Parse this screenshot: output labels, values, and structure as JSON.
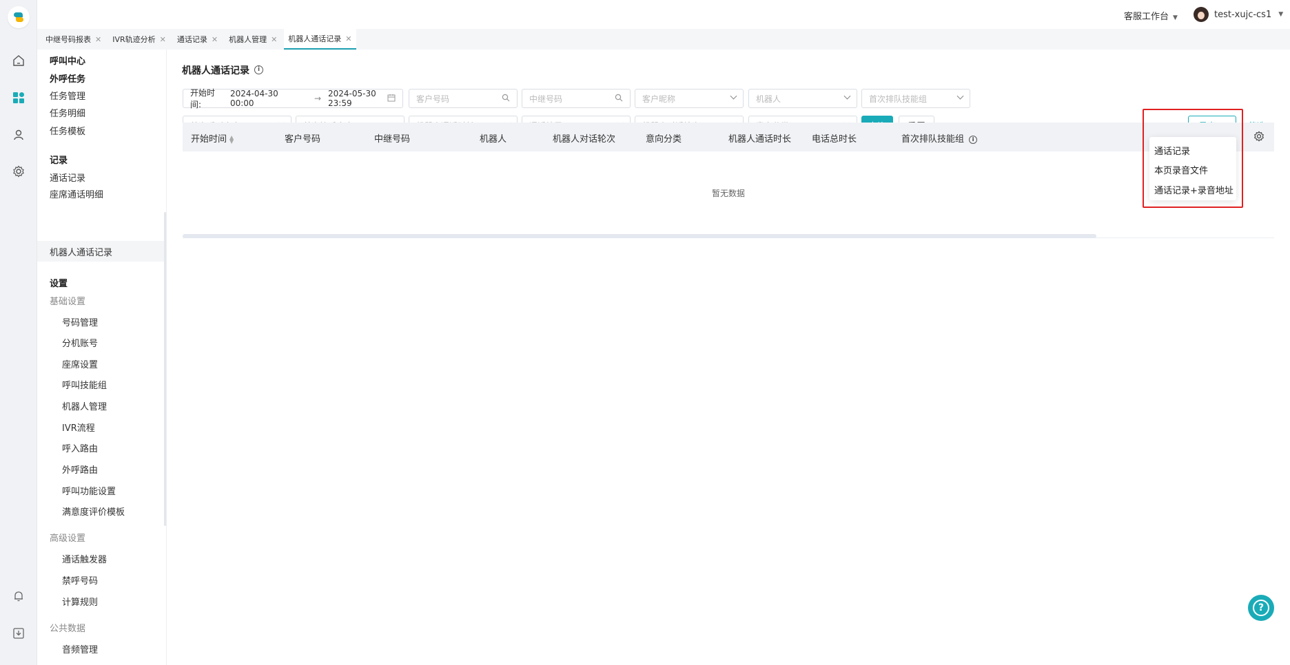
{
  "header": {
    "workspace": "客服工作台",
    "username": "test-xujc-cs1"
  },
  "tabs": [
    {
      "label": "中继号码报表"
    },
    {
      "label": "IVR轨迹分析"
    },
    {
      "label": "通话记录"
    },
    {
      "label": "机器人管理"
    },
    {
      "label": "机器人通话记录",
      "active": true
    }
  ],
  "rail_icons": [
    "home-icon",
    "apps-icon",
    "user-icon",
    "settings-icon",
    "bell-icon",
    "download-icon"
  ],
  "sidebar": {
    "call_center": "呼叫中心",
    "outbound_task": "外呼任务",
    "task_management": "任务管理",
    "task_detail": "任务明细",
    "task_template": "任务模板",
    "records": "记录",
    "call_records": "通话记录",
    "seat_call_detail": "座席通话明细",
    "robot_call_records": "机器人通话记录",
    "settings": "设置",
    "basic_settings": "基础设置",
    "number_management": "号码管理",
    "extension_account": "分机账号",
    "seat_settings": "座席设置",
    "call_skill_group": "呼叫技能组",
    "robot_management": "机器人管理",
    "ivr_flow": "IVR流程",
    "inbound_route": "呼入路由",
    "outbound_route": "外呼路由",
    "call_function_settings": "呼叫功能设置",
    "satisfaction_template": "满意度评价模板",
    "advanced_settings": "高级设置",
    "call_trigger": "通话触发器",
    "blocked_numbers": "禁呼号码",
    "billing_rules": "计算规则",
    "public_data": "公共数据",
    "audio_management": "音频管理"
  },
  "main": {
    "title": "机器人通话记录",
    "filters": {
      "start_time_label": "开始时间:",
      "start_time_from": "2024-04-30 00:00",
      "start_time_to": "2024-05-30 23:59",
      "customer_number": "客户号码",
      "trunk_number": "中继号码",
      "customer_nickname": "客户昵称",
      "robot": "机器人",
      "first_queue_skill_group": "首次排队技能组",
      "first_call_seat": "首次呼叫座席",
      "first_answer_seat": "首次接听座席",
      "robot_call_duration": "机器人通话时长",
      "call_result": "通话结果",
      "robot_dialogue_rounds": "机器人对话轮次",
      "intent_category": "意向分类"
    },
    "query_button": "查询",
    "reset_button": "重置",
    "export_button": "导出",
    "filter_link": "筛选",
    "table": {
      "columns": [
        "开始时间",
        "客户号码",
        "中继号码",
        "机器人",
        "机器人对话轮次",
        "意向分类",
        "机器人通话时长",
        "电话总时长",
        "首次排队技能组"
      ],
      "empty_text": "暂无数据"
    },
    "export_menu": [
      "通话记录",
      "本页录音文件",
      "通话记录+录音地址"
    ]
  },
  "colors": {
    "accent": "#1aabb8",
    "highlight_box": "#e02020"
  }
}
